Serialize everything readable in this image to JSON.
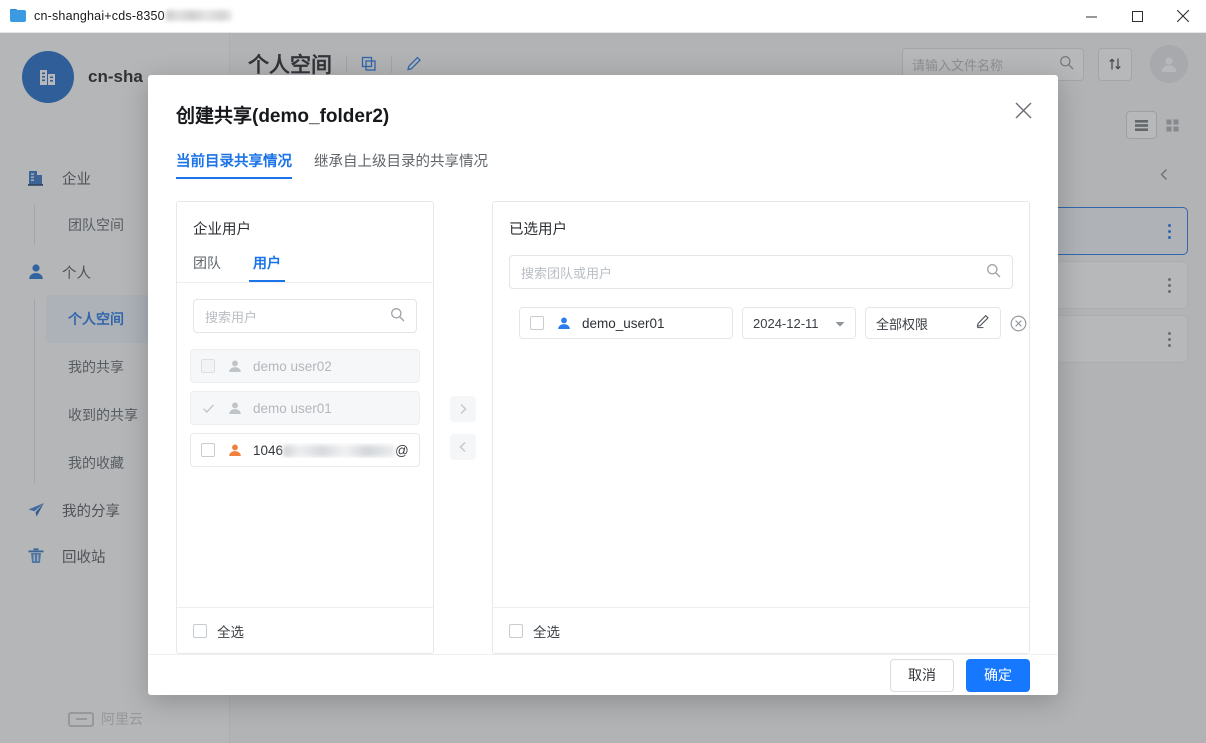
{
  "window": {
    "title": "cn-shanghai+cds-8350",
    "title_redacted": true,
    "folder_icon": "folder-icon",
    "minimize_label": "−",
    "maximize_label": "□",
    "close_label": "✕"
  },
  "background": {
    "brand": {
      "name": "cn-sha",
      "logo_icon": "company-building-icon"
    },
    "nav": [
      {
        "label": "企业",
        "icon": "enterprise-icon",
        "active": false,
        "children": [
          {
            "label": "团队空间",
            "active": false
          }
        ]
      },
      {
        "label": "个人",
        "icon": "person-icon",
        "active": false,
        "children": [
          {
            "label": "个人空间",
            "active": true
          },
          {
            "label": "我的共享",
            "active": false
          },
          {
            "label": "收到的共享",
            "active": false
          },
          {
            "label": "我的收藏",
            "active": false
          }
        ]
      },
      {
        "label": "我的分享",
        "icon": "send-icon",
        "active": false,
        "children": []
      },
      {
        "label": "回收站",
        "icon": "trash-icon",
        "active": false,
        "children": []
      }
    ],
    "vendor_logo": "阿里云",
    "page_title": "个人空间",
    "page_title_icons": [
      "copy-icon",
      "edit-icon"
    ],
    "search_placeholder": "请输入文件名称",
    "sort_icon": "sort-transfer-icon",
    "avatar_icon": "user-avatar-icon",
    "view_modes": [
      {
        "name": "list-view",
        "active": true
      },
      {
        "name": "grid-view",
        "active": false
      }
    ],
    "file_rows": [
      {
        "menu_icon": "more-vertical-icon",
        "selected": false,
        "collapse_icon": "chevron-left-icon"
      },
      {
        "menu_icon": "more-vertical-icon",
        "selected": true
      },
      {
        "menu_icon": "more-vertical-icon",
        "selected": false
      },
      {
        "menu_icon": "more-vertical-icon",
        "selected": false
      }
    ]
  },
  "modal": {
    "title": "创建共享(demo_folder2)",
    "close_icon": "close-icon",
    "tabs": [
      {
        "label": "当前目录共享情况",
        "active": true
      },
      {
        "label": "继承自上级目录的共享情况",
        "active": false
      }
    ],
    "left_panel": {
      "title": "企业用户",
      "tabs": [
        {
          "label": "团队",
          "active": false
        },
        {
          "label": "用户",
          "active": true
        }
      ],
      "search_placeholder": "搜索用户",
      "search_icon": "search-icon",
      "users": [
        {
          "name": "demo user02",
          "state": "disabled",
          "checked": false,
          "avatar": "user-avatar-gray-icon",
          "redacted": false
        },
        {
          "name": "demo user01",
          "state": "disabled",
          "checked": true,
          "avatar": "user-avatar-gray-icon",
          "redacted": false
        },
        {
          "name": "1046",
          "name_suffix": "@a...",
          "state": "enabled",
          "checked": false,
          "avatar": "user-avatar-orange-icon",
          "redacted": true
        }
      ],
      "select_all_label": "全选",
      "select_all_checked": false
    },
    "transfer": {
      "to_right_icon": "chevron-right-icon",
      "to_left_icon": "chevron-left-icon"
    },
    "right_panel": {
      "title": "已选用户",
      "search_placeholder": "搜索团队或用户",
      "search_icon": "search-icon",
      "selected": [
        {
          "name": "demo_user01",
          "avatar": "user-avatar-blue-icon",
          "checked": false,
          "date": "2024-12-11",
          "date_icon": "chevron-down-icon",
          "permission": "全部权限",
          "permission_icon": "edit-pencil-icon",
          "remove_icon": "remove-circle-icon"
        }
      ],
      "select_all_label": "全选",
      "select_all_checked": false
    },
    "footer": {
      "cancel_label": "取消",
      "confirm_label": "确定"
    }
  },
  "colors": {
    "accent": "#1a73e8",
    "primary_button": "#1677ff",
    "orange_avatar": "#f0803c",
    "overlay": "rgba(84,86,88,0.42)"
  }
}
